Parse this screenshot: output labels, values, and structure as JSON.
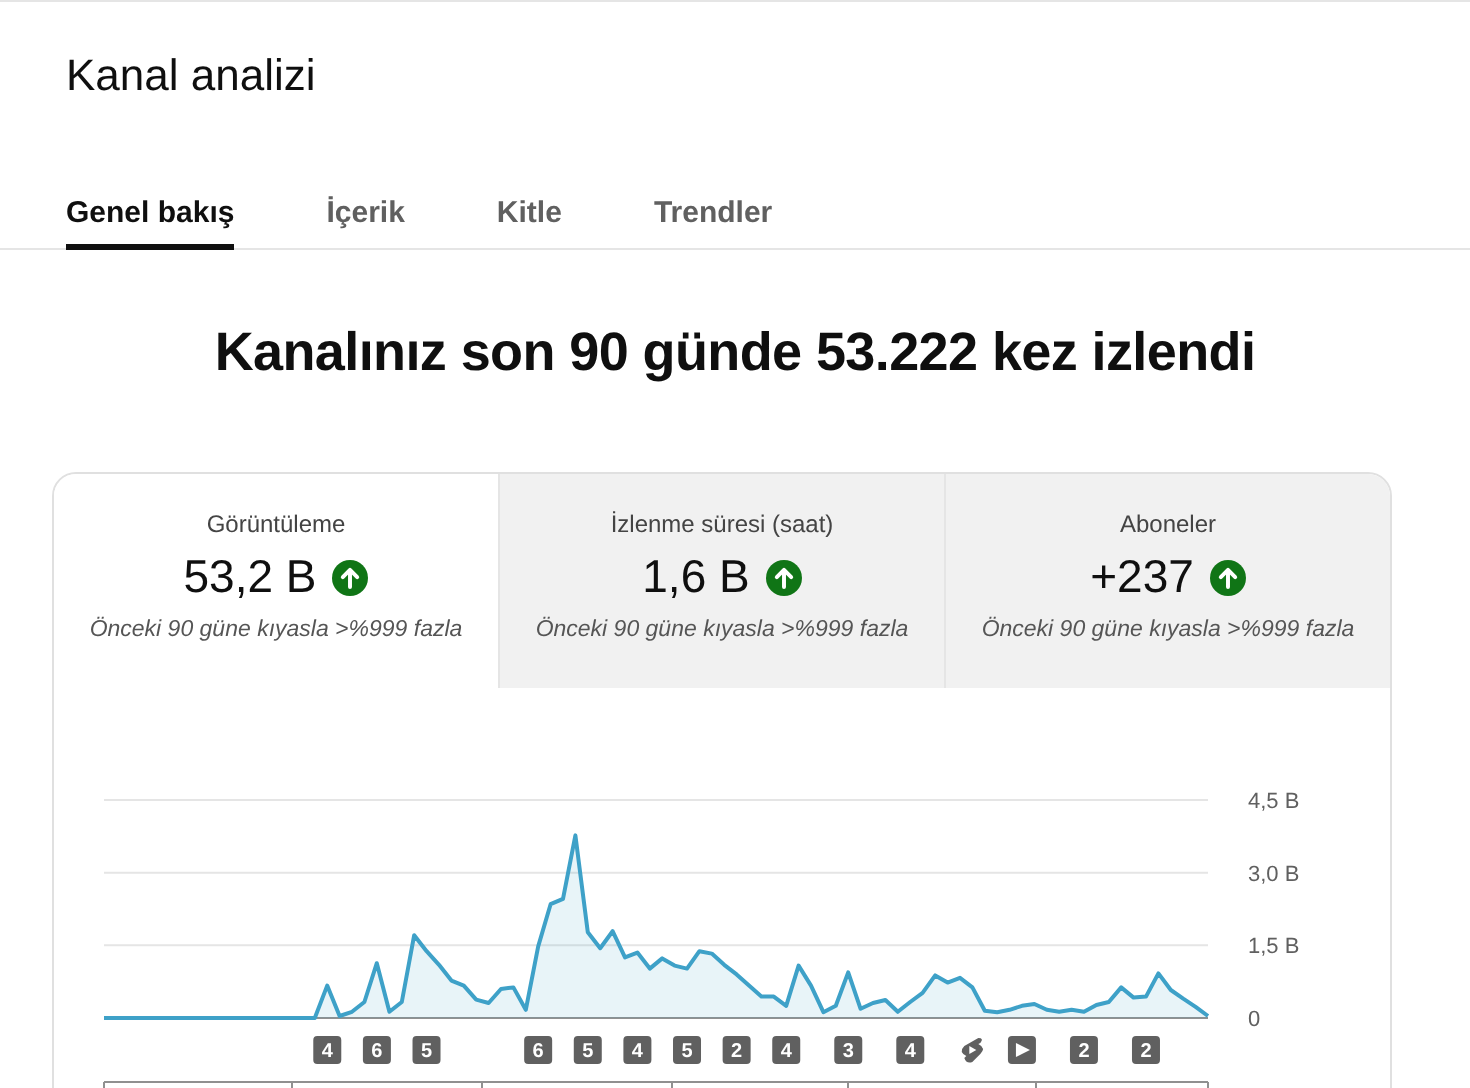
{
  "header": {
    "title": "Kanal analizi"
  },
  "tabs": [
    {
      "label": "Genel bakış",
      "selected": true
    },
    {
      "label": "İçerik",
      "selected": false
    },
    {
      "label": "Kitle",
      "selected": false
    },
    {
      "label": "Trendler",
      "selected": false
    }
  ],
  "headline": "Kanalınız son 90 günde 53.222 kez izlendi",
  "metrics": [
    {
      "label": "Görüntüleme",
      "value": "53,2 B",
      "comparison": "Önceki 90 güne kıyasla >%999 fazla",
      "selected": true
    },
    {
      "label": "İzlenme süresi (saat)",
      "value": "1,6 B",
      "comparison": "Önceki 90 güne kıyasla >%999 fazla",
      "selected": false
    },
    {
      "label": "Aboneler",
      "value": "+237",
      "comparison": "Önceki 90 güne kıyasla >%999 fazla",
      "selected": false
    }
  ],
  "chart_data": {
    "type": "area",
    "ylim": [
      0,
      4.5
    ],
    "yticks": [
      {
        "value": 0,
        "label": "0"
      },
      {
        "value": 1.5,
        "label": "1,5 B"
      },
      {
        "value": 3,
        "label": "3,0 B"
      },
      {
        "value": 4.5,
        "label": "4,5 B"
      }
    ],
    "series": [
      {
        "color": "#3ea1c8",
        "values": [
          0,
          0,
          0,
          0,
          0,
          0,
          0,
          0,
          0,
          0,
          0,
          0,
          0,
          0,
          0,
          0,
          0,
          0,
          0.67,
          0.04,
          0.13,
          0.33,
          1.13,
          0.13,
          0.33,
          1.71,
          1.38,
          1.1,
          0.77,
          0.67,
          0.38,
          0.31,
          0.6,
          0.63,
          0.17,
          1.48,
          2.35,
          2.46,
          3.77,
          1.77,
          1.44,
          1.79,
          1.25,
          1.35,
          1.02,
          1.23,
          1.08,
          1.02,
          1.38,
          1.33,
          1.1,
          0.9,
          0.67,
          0.44,
          0.44,
          0.25,
          1.08,
          0.67,
          0.12,
          0.25,
          0.94,
          0.19,
          0.31,
          0.37,
          0.13,
          0.33,
          0.52,
          0.88,
          0.73,
          0.83,
          0.63,
          0.15,
          0.12,
          0.17,
          0.25,
          0.29,
          0.17,
          0.13,
          0.17,
          0.13,
          0.27,
          0.33,
          0.63,
          0.42,
          0.44,
          0.92,
          0.58,
          0.4,
          0.23,
          0.04
        ]
      }
    ]
  },
  "upload_markers": [
    {
      "kind": "count",
      "label": "4"
    },
    {
      "kind": "count",
      "label": "6"
    },
    {
      "kind": "count",
      "label": "5"
    },
    {
      "kind": "count",
      "label": "6"
    },
    {
      "kind": "count",
      "label": "5"
    },
    {
      "kind": "count",
      "label": "4"
    },
    {
      "kind": "count",
      "label": "5"
    },
    {
      "kind": "count",
      "label": "2"
    },
    {
      "kind": "count",
      "label": "4"
    },
    {
      "kind": "count",
      "label": "3"
    },
    {
      "kind": "count",
      "label": "4"
    },
    {
      "kind": "shorts"
    },
    {
      "kind": "video"
    },
    {
      "kind": "count",
      "label": "2"
    },
    {
      "kind": "count",
      "label": "2"
    }
  ]
}
